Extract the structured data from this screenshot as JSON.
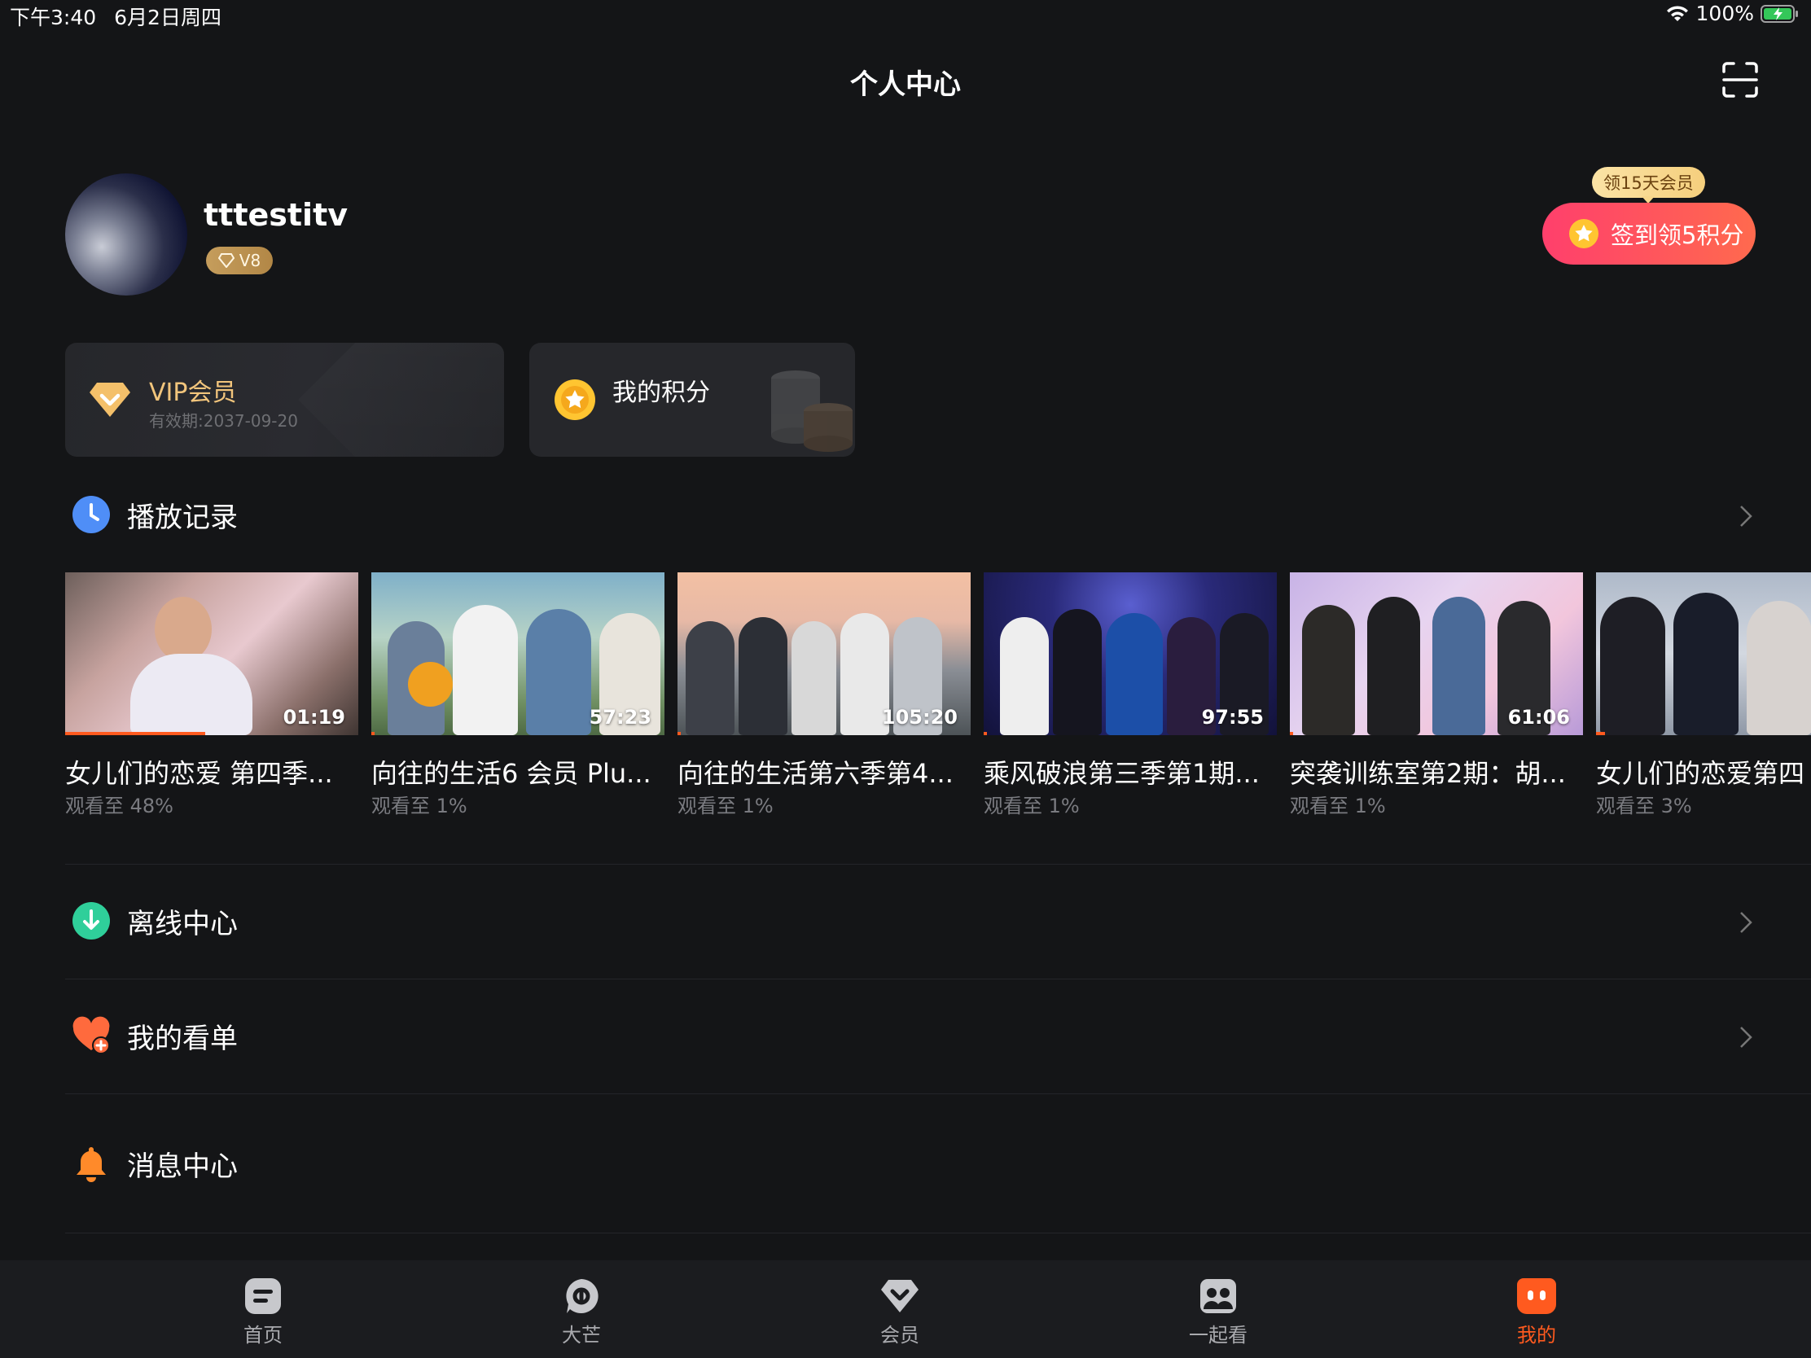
{
  "status_bar": {
    "time": "下午3:40",
    "date": "6月2日周四",
    "battery": "100%"
  },
  "header": {
    "title": "个人中心"
  },
  "profile": {
    "username": "tttestitv",
    "vip_level": "V8"
  },
  "checkin": {
    "tooltip": "领15天会员",
    "button_label": "签到领5积分"
  },
  "cards": {
    "vip": {
      "title": "VIP会员",
      "expiry": "有效期:2037-09-20"
    },
    "points": {
      "title": "我的积分"
    }
  },
  "history": {
    "title": "播放记录",
    "items": [
      {
        "duration": "01:19",
        "title": "女儿们的恋爱 第四季...",
        "progress_label": "观看至 48%",
        "progress": 0.48
      },
      {
        "duration": "57:23",
        "title": "向往的生活6 会员 Plu...",
        "progress_label": "观看至 1%",
        "progress": 0.01
      },
      {
        "duration": "105:20",
        "title": "向往的生活第六季第4...",
        "progress_label": "观看至 1%",
        "progress": 0.01
      },
      {
        "duration": "97:55",
        "title": "乘风破浪第三季第1期...",
        "progress_label": "观看至 1%",
        "progress": 0.01
      },
      {
        "duration": "61:06",
        "title": "突袭训练室第2期：胡...",
        "progress_label": "观看至 1%",
        "progress": 0.01
      },
      {
        "duration": "",
        "title": "女儿们的恋爱第四",
        "progress_label": "观看至 3%",
        "progress": 0.03
      }
    ]
  },
  "menu": {
    "offline": "离线中心",
    "watchlist": "我的看单",
    "messages": "消息中心"
  },
  "bottom_nav": [
    {
      "label": "首页",
      "active": false
    },
    {
      "label": "大芒",
      "active": false
    },
    {
      "label": "会员",
      "active": false
    },
    {
      "label": "一起看",
      "active": false
    },
    {
      "label": "我的",
      "active": true
    }
  ],
  "colors": {
    "accent": "#ff5a1f",
    "gold": "#f2c57c",
    "checkin_gradient_start": "#ff3f6c",
    "checkin_gradient_end": "#ff6a4e"
  }
}
